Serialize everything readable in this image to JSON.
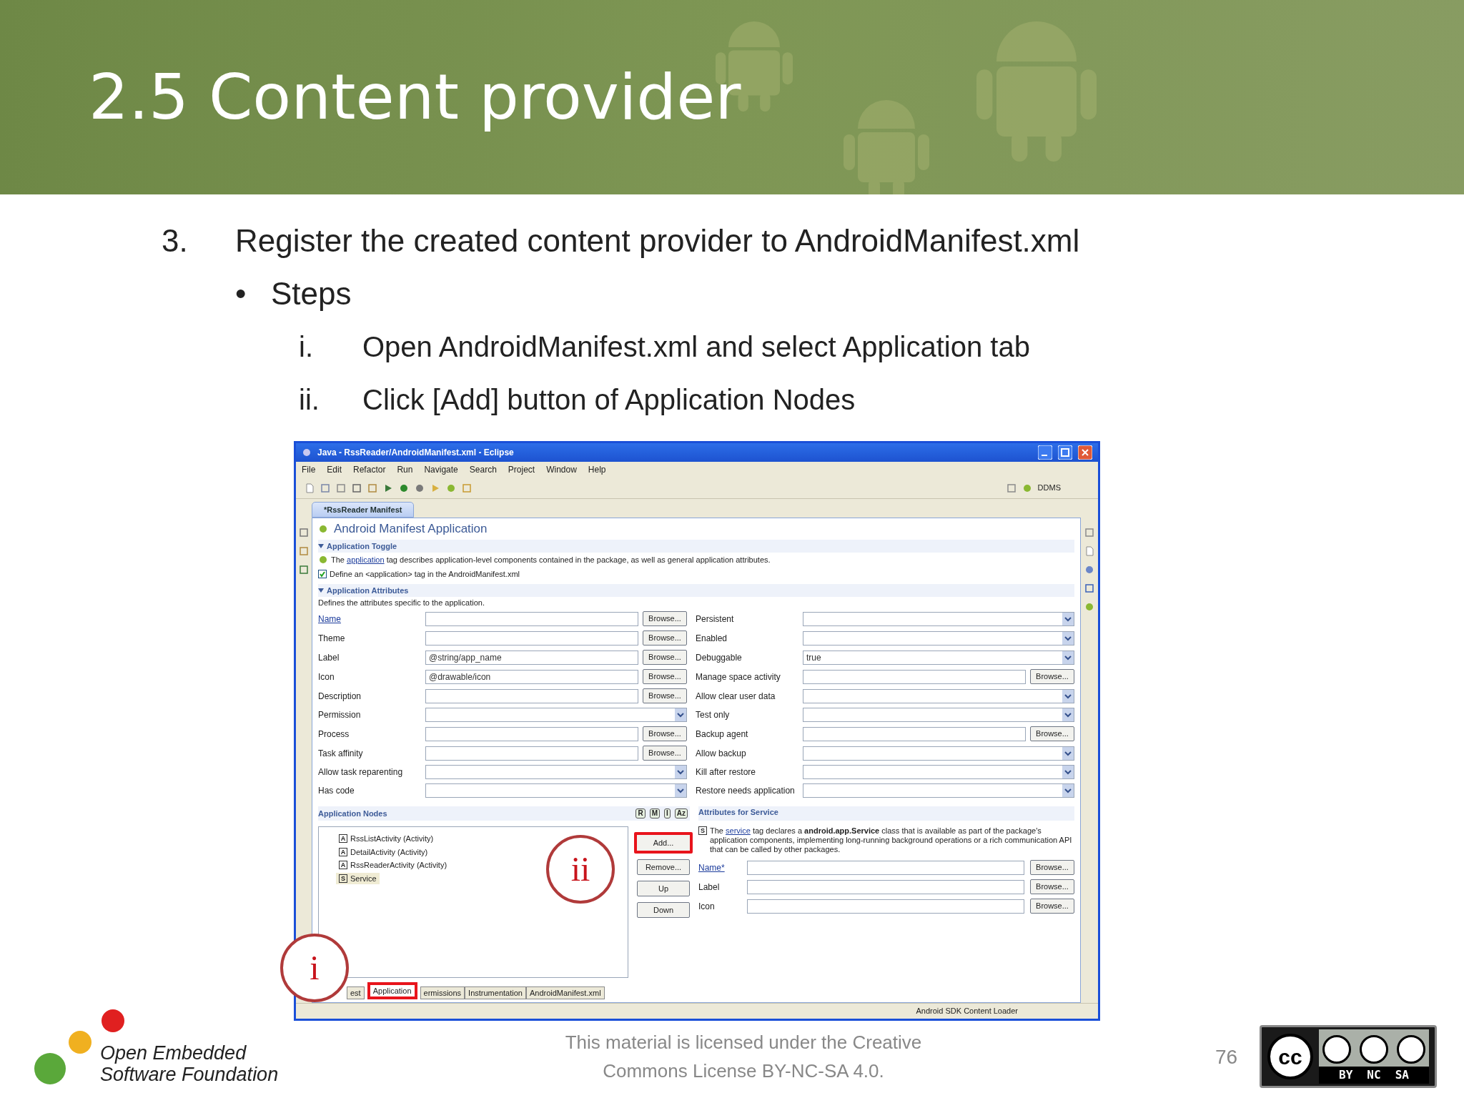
{
  "slide": {
    "title": "2.5 Content provider",
    "item": {
      "number": "3.",
      "text": "Register the created content provider to AndroidManifest.xml"
    },
    "bullet": {
      "marker": "•",
      "text": "Steps"
    },
    "steps": [
      {
        "numeral": "i.",
        "text": "Open AndroidManifest.xml and select Application tab"
      },
      {
        "numeral": "ii.",
        "text": "Click [Add] button of Application Nodes"
      }
    ]
  },
  "screenshot": {
    "window": {
      "title": "Java - RssReader/AndroidManifest.xml - Eclipse"
    },
    "menu": [
      "File",
      "Edit",
      "Refactor",
      "Run",
      "Navigate",
      "Search",
      "Project",
      "Window",
      "Help"
    ],
    "perspective": "DDMS",
    "editor_tab": "*RssReader Manifest",
    "form_title": "Android Manifest Application",
    "toggle": {
      "title": "Application Toggle",
      "before": "The ",
      "link": "application",
      "after": " tag describes application-level components contained in the package, as well as general application attributes.",
      "checkbox": {
        "label": "Define an <application> tag in the AndroidManifest.xml",
        "checked": true
      }
    },
    "attributes": {
      "title": "Application Attributes",
      "description": "Defines the attributes specific to the application.",
      "rows": [
        {
          "left": {
            "label": "Name",
            "link": true,
            "kind": "browse",
            "button": "Browse..."
          },
          "right": {
            "label": "Persistent",
            "link": false,
            "kind": "combo"
          }
        },
        {
          "left": {
            "label": "Theme",
            "link": false,
            "kind": "browse",
            "button": "Browse..."
          },
          "right": {
            "label": "Enabled",
            "link": false,
            "kind": "combo"
          }
        },
        {
          "left": {
            "label": "Label",
            "link": false,
            "kind": "browse",
            "value": "@string/app_name",
            "button": "Browse..."
          },
          "right": {
            "label": "Debuggable",
            "link": false,
            "kind": "combo",
            "value": "true"
          }
        },
        {
          "left": {
            "label": "Icon",
            "link": false,
            "kind": "browse",
            "value": "@drawable/icon",
            "button": "Browse..."
          },
          "right": {
            "label": "Manage space activity",
            "link": false,
            "kind": "browse",
            "button": "Browse..."
          }
        },
        {
          "left": {
            "label": "Description",
            "link": false,
            "kind": "browse",
            "button": "Browse..."
          },
          "right": {
            "label": "Allow clear user data",
            "link": false,
            "kind": "combo"
          }
        },
        {
          "left": {
            "label": "Permission",
            "link": false,
            "kind": "combo"
          },
          "right": {
            "label": "Test only",
            "link": false,
            "kind": "combo"
          }
        },
        {
          "left": {
            "label": "Process",
            "link": false,
            "kind": "browse",
            "button": "Browse..."
          },
          "right": {
            "label": "Backup agent",
            "link": false,
            "kind": "browse",
            "button": "Browse..."
          }
        },
        {
          "left": {
            "label": "Task affinity",
            "link": false,
            "kind": "browse",
            "button": "Browse..."
          },
          "right": {
            "label": "Allow backup",
            "link": false,
            "kind": "combo"
          }
        },
        {
          "left": {
            "label": "Allow task reparenting",
            "link": false,
            "kind": "combo"
          },
          "right": {
            "label": "Kill after restore",
            "link": false,
            "kind": "combo"
          }
        },
        {
          "left": {
            "label": "Has code",
            "link": false,
            "kind": "combo"
          },
          "right": {
            "label": "Restore needs application",
            "link": false,
            "kind": "combo"
          }
        }
      ]
    },
    "nodes": {
      "title": "Application Nodes",
      "sort_buttons": [
        "R",
        "M",
        "I",
        "Az"
      ],
      "items": [
        {
          "letter": "A",
          "label": "RssListActivity (Activity)",
          "selected": false
        },
        {
          "letter": "A",
          "label": "DetailActivity (Activity)",
          "selected": false
        },
        {
          "letter": "A",
          "label": "RssReaderActivity (Activity)",
          "selected": false
        },
        {
          "letter": "S",
          "label": "Service",
          "selected": true
        }
      ],
      "buttons": [
        {
          "label": "Add...",
          "highlighted": true
        },
        {
          "label": "Remove...",
          "highlighted": false
        },
        {
          "label": "Up",
          "highlighted": false
        },
        {
          "label": "Down",
          "highlighted": false
        }
      ]
    },
    "service": {
      "title": "Attributes for Service",
      "letter": "S",
      "before": "The ",
      "link": "service",
      "after": " tag declares a **android.app.Service** class that is available as part of the package's application components, implementing long-running background operations or a rich communication API that can be called by other packages.",
      "fields": [
        {
          "label": "Name*",
          "link": true,
          "button": "Browse..."
        },
        {
          "label": "Label",
          "link": false,
          "button": "Browse..."
        },
        {
          "label": "Icon",
          "link": false,
          "button": "Browse..."
        }
      ]
    },
    "bottom_tabs": [
      {
        "label": "est",
        "selected": false,
        "highlighted": false
      },
      {
        "label": "Application",
        "selected": true,
        "highlighted": true
      },
      {
        "label": "ermissions",
        "selected": false,
        "highlighted": false
      },
      {
        "label": "Instrumentation",
        "selected": false,
        "highlighted": false
      },
      {
        "label": "AndroidManifest.xml",
        "selected": false,
        "highlighted": false
      }
    ],
    "status": "Android SDK Content Loader"
  },
  "callouts": [
    {
      "label": "i"
    },
    {
      "label": "ii"
    }
  ],
  "footer": {
    "logo_lines": [
      "Open Embedded",
      "Software Foundation"
    ],
    "license_lines": [
      "This material is licensed under the Creative",
      "Commons License BY-NC-SA 4.0."
    ],
    "page": "76",
    "cc": {
      "mark": "cc",
      "terms": [
        "BY",
        "NC",
        "SA"
      ]
    }
  }
}
